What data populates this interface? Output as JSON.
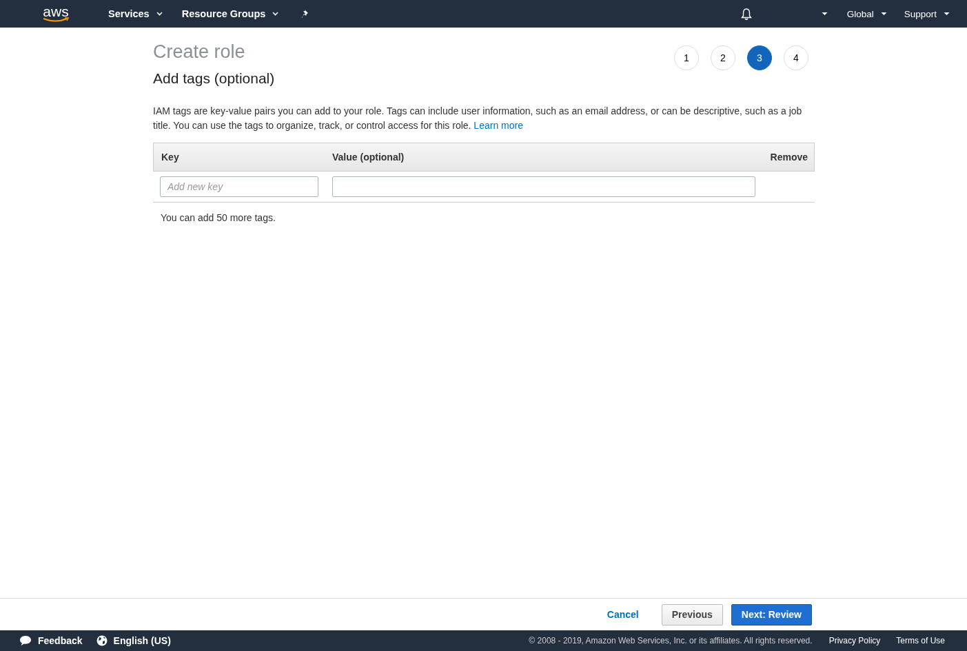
{
  "top_nav": {
    "logo": "aws",
    "menus": [
      {
        "label": "Services"
      },
      {
        "label": "Resource Groups"
      }
    ],
    "right_menus": [
      {
        "label": "Global"
      },
      {
        "label": "Support"
      }
    ]
  },
  "title": "Create role",
  "steps": [
    {
      "label": "1",
      "selected": false
    },
    {
      "label": "2",
      "selected": false
    },
    {
      "label": "3",
      "selected": true
    },
    {
      "label": "4",
      "selected": false
    }
  ],
  "section_title": "Add tags (optional)",
  "description": "IAM tags are key-value pairs you can add to your role. Tags can include user information, such as an email address, or can be descriptive, such as a job title. You can use the tags to organize, track, or control access for this role.",
  "learn_more": "Learn more",
  "table": {
    "columns": [
      "Key",
      "Value (optional)",
      "Remove"
    ],
    "key_placeholder": "Add new key"
  },
  "tags_remaining": "You can add 50 more tags.",
  "actions": {
    "cancel": "Cancel",
    "previous": "Previous",
    "next": "Next: Review"
  },
  "footer": {
    "feedback": "Feedback",
    "language": "English (US)",
    "copyright": "© 2008 - 2019, Amazon Web Services, Inc. or its affiliates. All rights reserved.",
    "links": [
      "Privacy Policy",
      "Terms of Use"
    ]
  }
}
